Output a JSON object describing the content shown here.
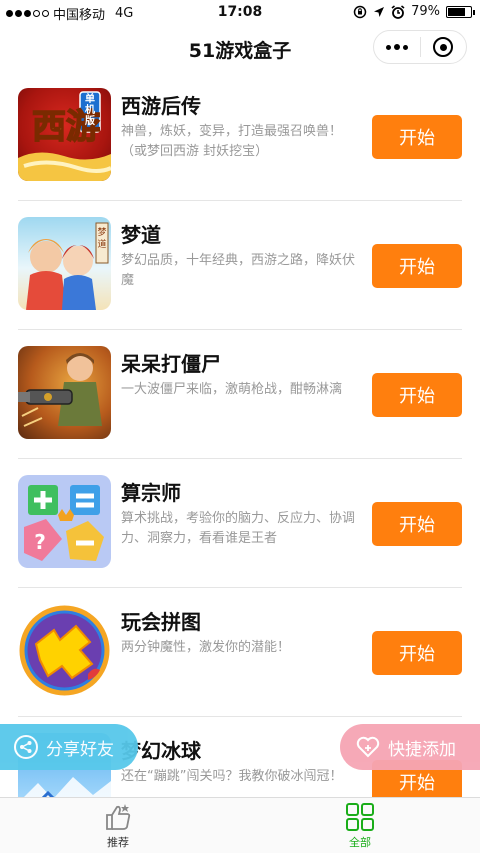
{
  "status_bar": {
    "carrier": "中国移动",
    "network": "4G",
    "time": "17:08",
    "battery": "79%",
    "battery_level": 0.79
  },
  "nav": {
    "title": "51游戏盒子"
  },
  "games": [
    {
      "title": "西游后传",
      "description": "神兽，炼妖，变异，打造最强召唤兽！（或梦回西游 封妖挖宝）",
      "button": "开始",
      "thumb_text": "西游",
      "thumb_badge": "单机版"
    },
    {
      "title": "梦道",
      "description": "梦幻品质，十年经典，西游之路，降妖伏魔",
      "button": "开始",
      "thumb_badge": "梦道"
    },
    {
      "title": "呆呆打僵尸",
      "description": "一大波僵尸来临，激萌枪战，酣畅淋漓",
      "button": "开始"
    },
    {
      "title": "算宗师",
      "description": "算术挑战，考验你的脑力、反应力、协调力、洞察力，看看谁是王者",
      "button": "开始"
    },
    {
      "title": "玩会拼图",
      "description": "两分钟魔性，激发你的潜能！",
      "button": "开始"
    },
    {
      "title": "梦幻冰球",
      "description": "还在“蹦跳”闯关吗？我教你破冰闯冠！",
      "button": "开始"
    }
  ],
  "floating": {
    "share_label": "分享好友",
    "add_label": "快捷添加"
  },
  "tabs": [
    {
      "label": "推荐",
      "active": false
    },
    {
      "label": "全部",
      "active": true
    }
  ],
  "colors": {
    "accent": "#ff7f0e",
    "tab_active": "#1aad19",
    "share_bg": "#57c8ea",
    "add_bg": "#f6a5b4"
  }
}
